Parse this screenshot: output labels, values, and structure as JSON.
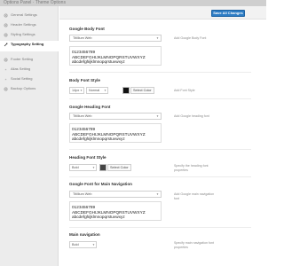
{
  "window": {
    "title": "Options Panel · Theme Options"
  },
  "header": {
    "save_label": "Save All Changes"
  },
  "sidebar": {
    "items": [
      {
        "label": "General Settings",
        "icon": "gear-icon"
      },
      {
        "label": "Header Settings",
        "icon": "gear-icon"
      },
      {
        "label": "Styling Settings",
        "icon": "gear-icon"
      },
      {
        "label": "Typography Setting",
        "icon": "brush-icon"
      },
      {
        "label": "Footer Setting",
        "icon": "gear-icon"
      },
      {
        "label": "Alias Setting",
        "icon": "bullet-icon"
      },
      {
        "label": "Social Setting",
        "icon": "bullet-icon"
      },
      {
        "label": "Backup Options",
        "icon": "gear-icon"
      }
    ]
  },
  "sections": {
    "body_font": {
      "title": "Google Body Font",
      "value": "Titillium Web",
      "desc": "Add Google Body Font",
      "preview_line1": "0123456789",
      "preview_line2": "ABCDEFGHIJKLMNOPQRSTUVWXYZ",
      "preview_line3": "abcdefghijklmnopqrstuvwxyz"
    },
    "body_style": {
      "title": "Body Font Style",
      "size": "14px",
      "weight": "Normal",
      "color_label": "Select Color",
      "color": "#111111",
      "desc": "Add Font Style"
    },
    "heading_font": {
      "title": "Google Heading Font",
      "value": "Titillium Web",
      "desc": "Add Google heading font",
      "preview_line1": "0123456789",
      "preview_line2": "ABCDEFGHIJKLMNOPQRSTUVWXYZ",
      "preview_line3": "abcdefghijklmnopqrstuvwxyz"
    },
    "heading_style": {
      "title": "Heading Font Style",
      "weight": "Bold",
      "color_label": "Select Color",
      "color": "#444444",
      "desc": "Specify the heading font properties"
    },
    "nav_font": {
      "title": "Google Font for Main Navigation",
      "value": "Titillium Web",
      "desc": "Add Google main navigation font",
      "preview_line1": "0123456789",
      "preview_line2": "ABCDEFGHIJKLMNOPQRSTUVWXYZ",
      "preview_line3": "abcdefghijklmnopqrstuvwxyz"
    },
    "nav_style": {
      "title": "Main navigation",
      "weight": "Bold",
      "desc": "Specify main navigation font properties"
    }
  },
  "colors": {
    "accent": "#2d7cc4",
    "sidebar_bg": "#ececec"
  }
}
